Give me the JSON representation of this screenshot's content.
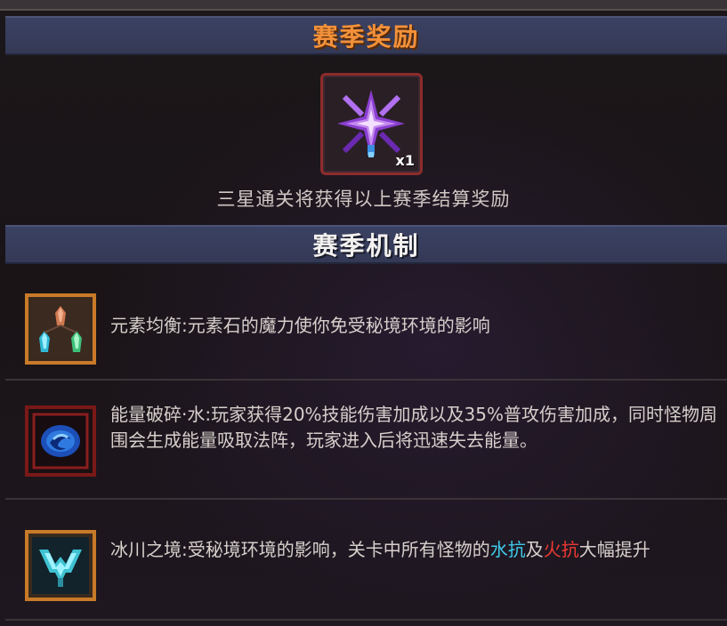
{
  "reward_section": {
    "title": "赛季奖励",
    "item_icon": "purple-crystal-star-icon",
    "quantity": "x1",
    "description": "三星通关将获得以上赛季结算奖励"
  },
  "mechanics_section": {
    "title": "赛季机制",
    "items": [
      {
        "icon": "elemental-stones-icon",
        "text": "元素均衡:元素石的魔力使你免受秘境环境的影响"
      },
      {
        "icon": "blue-energy-swirl-icon",
        "text": "能量破碎·水:玩家获得20%技能伤害加成以及35%普攻伤害加成，同时怪物周围会生成能量吸取法阵，玩家进入后将迅速失去能量。"
      },
      {
        "icon": "glacier-emblem-icon",
        "text_before": "冰川之境:受秘境环境的影响，关卡中所有怪物的",
        "water_res": "水抗",
        "connector": "及",
        "fire_res": "火抗",
        "text_after": "大幅提升"
      }
    ]
  },
  "colors": {
    "header_title_orange": "#f2913a",
    "water": "#3ec9e8",
    "fire": "#ee3a34",
    "header_bar": "#3b4162"
  }
}
